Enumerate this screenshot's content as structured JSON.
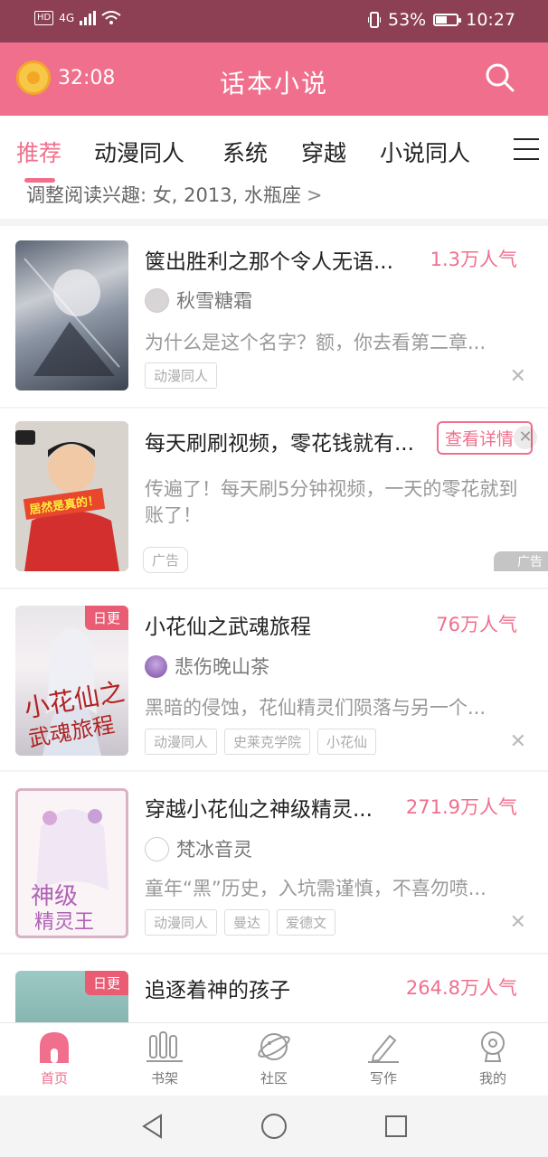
{
  "status_bar": {
    "network": "4G",
    "hd": "HD",
    "battery": "53%",
    "battery_level": 0.53,
    "time": "10:27"
  },
  "header": {
    "timer": "32:08",
    "title": "话本小说"
  },
  "tabs": [
    "推荐",
    "动漫同人",
    "系统",
    "穿越",
    "小说同人"
  ],
  "active_tab": 0,
  "interest": {
    "text": "调整阅读兴趣: 女, 2013, 水瓶座"
  },
  "books": [
    {
      "title": "箧出胜利之那个令人无语...",
      "popularity": "1.3万人气",
      "author": "秋雪糖霜",
      "desc": "为什么是这个名字？额，你去看第二章...",
      "tags": [
        "动漫同人"
      ],
      "badge": ""
    },
    {
      "title": "小花仙之武魂旅程",
      "popularity": "76万人气",
      "author": "悲伤晚山茶",
      "desc": "黑暗的侵蚀，花仙精灵们陨落与另一个...",
      "tags": [
        "动漫同人",
        "史莱克学院",
        "小花仙"
      ],
      "badge": "日更"
    },
    {
      "title": "穿越小花仙之神级精灵...",
      "popularity": "271.9万人气",
      "author": "梵冰音灵",
      "desc": "童年“黑”历史，入坑需谨慎，不喜勿喷...",
      "tags": [
        "动漫同人",
        "曼达",
        "爱德文"
      ],
      "badge": ""
    },
    {
      "title": "追逐着神的孩子",
      "popularity": "264.8万人气",
      "author": "",
      "desc": "",
      "tags": [],
      "badge": "日更"
    }
  ],
  "ad": {
    "title": "每天刷刷视频，零花钱就有...",
    "detail_button": "查看详情",
    "desc": "传遍了！每天刷5分钟视频，一天的零花就到账了！",
    "tag": "广告",
    "ad_mark": "广告",
    "cover_caption": "居然是真的！"
  },
  "bottom_nav": [
    "首页",
    "书架",
    "社区",
    "写作",
    "我的"
  ],
  "colors": {
    "brand": "#f06f8d",
    "status_bar": "#8d3f53"
  },
  "icons": {
    "search": "search-icon",
    "menu": "menu-icon",
    "close": "close-icon",
    "coin": "coin-timer-icon"
  }
}
